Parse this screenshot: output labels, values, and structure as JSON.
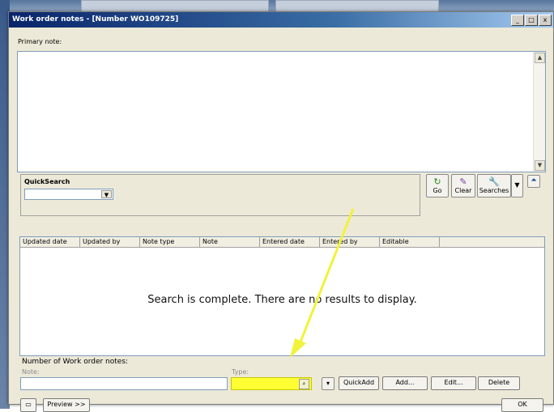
{
  "window": {
    "title": "Work order notes - [Number WO109725]",
    "buttons": {
      "minimize": "_",
      "maximize": "□",
      "close": "x"
    }
  },
  "primary_note": {
    "label": "Primary note:",
    "value": ""
  },
  "quicksearch": {
    "title": "QuickSearch",
    "value": "",
    "go_label": "Go",
    "clear_label": "Clear",
    "searches_label": "Searches"
  },
  "grid": {
    "columns": [
      "Updated date",
      "Updated by",
      "Note type",
      "Note",
      "Entered date",
      "Entered by",
      "Editable"
    ],
    "empty_message": "Search is complete. There are no results to display."
  },
  "footer": {
    "count_label": "Number of Work order notes:",
    "note_label": "Note:",
    "note_value": "",
    "type_label": "Type:",
    "type_value": "",
    "quickadd_label": "QuickAdd",
    "add_label": "Add...",
    "edit_label": "Edit...",
    "delete_label": "Delete",
    "preview_label": "Preview >>",
    "ok_label": "OK"
  },
  "colors": {
    "highlight": "#ffff33",
    "arrow": "#f2f23a",
    "titlebar": "#0a246a"
  }
}
